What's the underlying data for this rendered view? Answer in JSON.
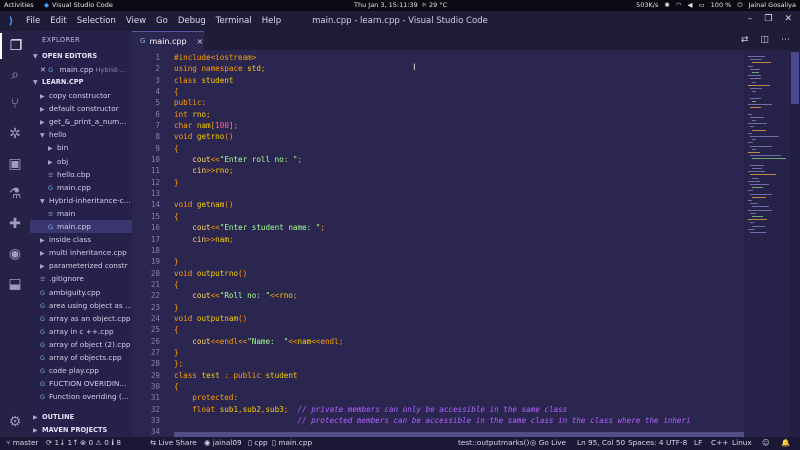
{
  "topbar": {
    "activities": "Activities",
    "app_name": "Visual Studio Code",
    "datetime": "Thu Jan  3, 15:11:39",
    "weather": "29 °C",
    "net_speed": "503K/s",
    "battery": "100 %",
    "user": "Jainal Gosaliya"
  },
  "window": {
    "title": "main.cpp - learn.cpp - Visual Studio Code",
    "menu": [
      "File",
      "Edit",
      "Selection",
      "View",
      "Go",
      "Debug",
      "Terminal",
      "Help"
    ]
  },
  "sidebar": {
    "header": "EXPLORER",
    "open_editors_label": "OPEN EDITORS",
    "open_editor_file": "main.cpp",
    "open_editor_path": "Hybrid-...",
    "workspace_label": "LEARN.CPP",
    "items": [
      {
        "label": "copy constructor",
        "kind": "folder"
      },
      {
        "label": "default constructor",
        "kind": "folder"
      },
      {
        "label": "get_&_print_a_num...",
        "kind": "folder"
      },
      {
        "label": "hello",
        "kind": "folder-open"
      },
      {
        "label": "bin",
        "kind": "folder",
        "indent": 1
      },
      {
        "label": "obj",
        "kind": "folder",
        "indent": 1
      },
      {
        "label": "hello.cbp",
        "kind": "file",
        "indent": 1
      },
      {
        "label": "main.cpp",
        "kind": "cpp",
        "indent": 1
      },
      {
        "label": "Hybrid-inheritance-c...",
        "kind": "folder-open"
      },
      {
        "label": "main",
        "kind": "file",
        "indent": 1
      },
      {
        "label": "main.cpp",
        "kind": "cpp",
        "indent": 1,
        "selected": true
      },
      {
        "label": "inside class",
        "kind": "folder"
      },
      {
        "label": "multi inheritance.cpp",
        "kind": "folder"
      },
      {
        "label": "parameterized constr",
        "kind": "folder"
      },
      {
        "label": ".gitignore",
        "kind": "file"
      },
      {
        "label": "ambiguity.cpp",
        "kind": "cpp"
      },
      {
        "label": "area using object as ...",
        "kind": "cpp"
      },
      {
        "label": "array as an object.cpp",
        "kind": "cpp"
      },
      {
        "label": "array in c ++.cpp",
        "kind": "cpp"
      },
      {
        "label": "array of object (2).cpp",
        "kind": "cpp"
      },
      {
        "label": "array of objects.cpp",
        "kind": "cpp"
      },
      {
        "label": "code play.cpp",
        "kind": "cpp"
      },
      {
        "label": "FUCTION OVERIDIN...",
        "kind": "cpp"
      },
      {
        "label": "Function overiding (...",
        "kind": "cpp"
      }
    ],
    "outline_label": "OUTLINE",
    "maven_label": "MAVEN PROJECTS"
  },
  "tab": {
    "label": "main.cpp",
    "close": "×"
  },
  "editor": {
    "line_numbers": [
      "1",
      "2",
      "3",
      "4",
      "5",
      "6",
      "7",
      "8",
      "9",
      "10",
      "11",
      "12",
      "13",
      "14",
      "15",
      "16",
      "17",
      "18",
      "19",
      "20",
      "21",
      "22",
      "23",
      "24",
      "25",
      "26",
      "27",
      "28",
      "29",
      "30",
      "31",
      "32",
      "33",
      "34"
    ],
    "lines": [
      "#include<iostream>",
      "using namespace std;",
      "class student",
      "{",
      "public:",
      "int rno;",
      "char nam[100];",
      "void getrno()",
      "{",
      "    cout<<\"Enter roll no: \";",
      "    cin>>rno;",
      "}",
      "",
      "void getnam()",
      "{",
      "    cout<<\"Enter student name: \";",
      "    cin>>nam;",
      "",
      "}",
      "void outputrno()",
      "{",
      "    cout<<\"Roll no: \"<<rno;",
      "}",
      "void outputnam()",
      "{",
      "    cout<<endl<<\"Name:  \"<<nam<<endl;",
      "}",
      "};",
      "class test : public student",
      "{",
      "    protected:",
      "    float sub1,sub2,sub3;  // private members can only be accessible in the same class",
      "                           // protected members can be accessible in the same class in the class where the inheri",
      ""
    ]
  },
  "status": {
    "branch": "master",
    "sync": "1↓ 1↑",
    "errors": "0",
    "warnings": "0",
    "info": "8",
    "live_share": "Live Share",
    "user": "jainal09",
    "lang_ext": "cpp",
    "file": "main.cpp",
    "symbol": "test::outputmarks()",
    "go_live": "Go Live",
    "position": "Ln 95, Col 50",
    "spaces": "Spaces: 4",
    "encoding": "UTF-8",
    "eol": "LF",
    "language": "C++",
    "os": "Linux"
  }
}
